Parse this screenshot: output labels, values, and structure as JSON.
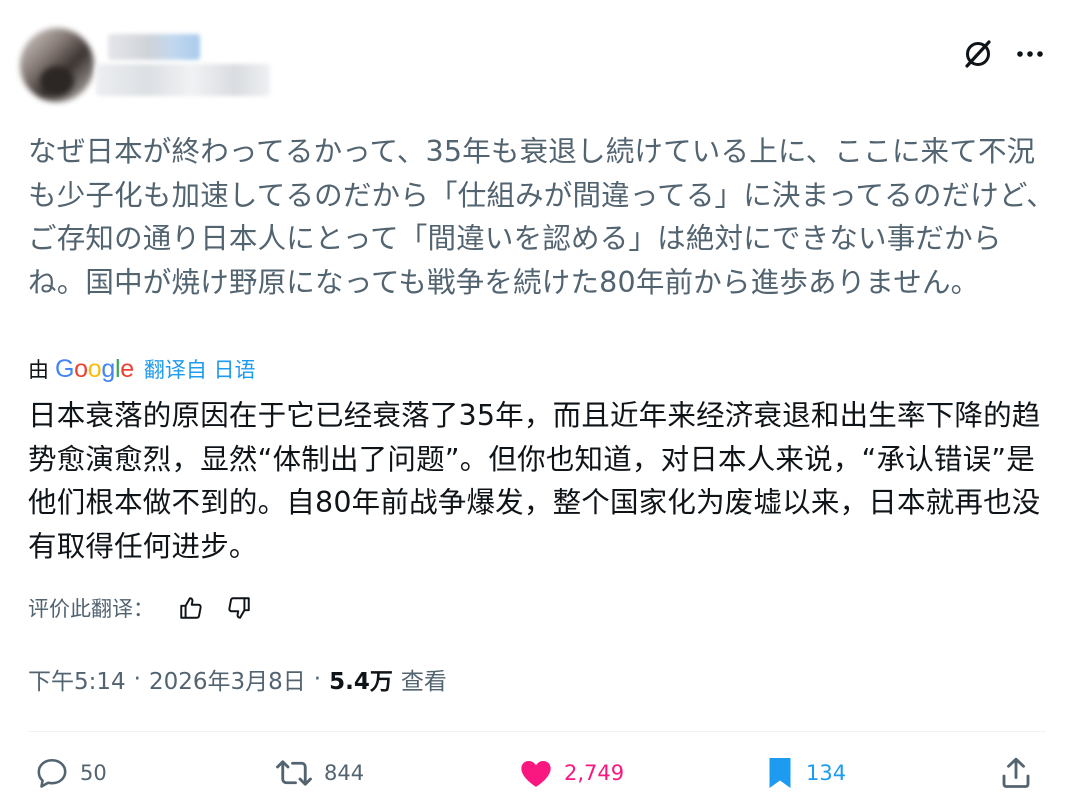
{
  "post": {
    "original_text": "なぜ日本が終わってるかって、35年も衰退し続けている上に、ここに来て不況も少子化も加速してるのだから「仕組みが間違ってる」に決まってるのだけど、ご存知の通り日本人にとって「間違いを認める」は絶対にできない事だからね。国中が焼け野原になっても戦争を続けた80年前から進歩ありません。",
    "translation": {
      "by_label": "由",
      "provider_letters": [
        "G",
        "o",
        "o",
        "g",
        "l",
        "e"
      ],
      "from_label": "翻译自 日语",
      "text": "日本衰落的原因在于它已经衰落了35年，而且近年来经济衰退和出生率下降的趋势愈演愈烈，显然“体制出了问题”。但你也知道，对日本人来说，“承认错误”是他们根本做不到的。自80年前战争爆发，整个国家化为废墟以来，日本就再也没有取得任何进步。",
      "rate_label": "评价此翻译："
    },
    "meta": {
      "time": "下午5:14",
      "date": "2026年3月8日",
      "separator": "·",
      "views_count": "5.4万",
      "views_label": "查看"
    },
    "actions": {
      "replies": "50",
      "reposts": "844",
      "likes": "2,749",
      "bookmarks": "134"
    },
    "icons": {
      "grok": "grok-icon",
      "more": "more-icon",
      "thumbs_up": "thumbs-up-icon",
      "thumbs_down": "thumbs-down-icon",
      "reply": "reply-icon",
      "repost": "repost-icon",
      "like": "heart-icon",
      "bookmark": "bookmark-icon",
      "share": "share-icon"
    },
    "colors": {
      "secondary_text": "#536471",
      "primary_text": "#0f1419",
      "link": "#1d9bf0",
      "like": "#f91880"
    }
  }
}
